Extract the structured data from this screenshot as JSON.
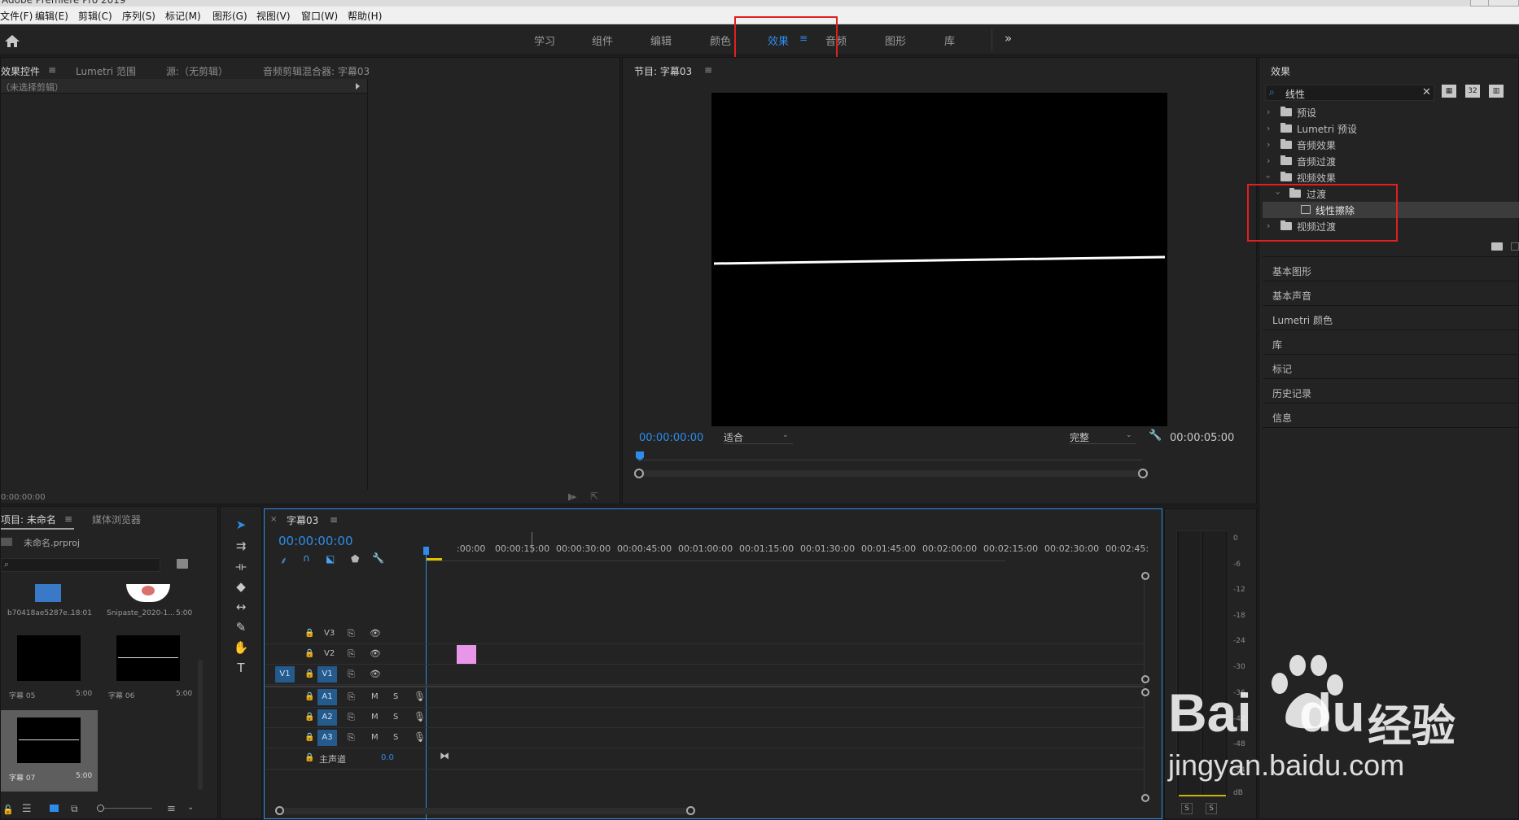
{
  "menubar": {
    "items": [
      "文件(F)",
      "编辑(E)",
      "剪辑(C)",
      "序列(S)",
      "标记(M)",
      "图形(G)",
      "视图(V)",
      "窗口(W)",
      "帮助(H)"
    ]
  },
  "workspaces": {
    "tabs": [
      "学习",
      "组件",
      "编辑",
      "颜色",
      "效果",
      "音频",
      "图形",
      "库"
    ],
    "active": "效果",
    "more": "»"
  },
  "effect_controls": {
    "tabs": [
      "效果控件",
      "Lumetri 范围",
      "源:（无剪辑）",
      "音频剪辑混合器: 字幕03"
    ],
    "no_clip": "（未选择剪辑）",
    "timecode": "0:00:00:00"
  },
  "program_monitor": {
    "title": "节目: 字幕03",
    "timecode_current": "00:00:00:00",
    "fit_label": "适合",
    "quality_label": "完整",
    "timecode_duration": "00:00:05:00"
  },
  "effects_panel": {
    "title": "效果",
    "search_value": "线性",
    "tree": [
      {
        "label": "预设",
        "icon": "preset-folder-icon",
        "level": 0,
        "expanded": false
      },
      {
        "label": "Lumetri 预设",
        "icon": "preset-folder-icon",
        "level": 0,
        "expanded": false
      },
      {
        "label": "音频效果",
        "icon": "folder-icon",
        "level": 0,
        "expanded": false
      },
      {
        "label": "音频过渡",
        "icon": "folder-icon",
        "level": 0,
        "expanded": false
      },
      {
        "label": "视频效果",
        "icon": "folder-icon",
        "level": 0,
        "expanded": true
      },
      {
        "label": "过渡",
        "icon": "folder-icon",
        "level": 1,
        "expanded": true
      },
      {
        "label": "线性擦除",
        "icon": "effect-icon",
        "level": 2,
        "selected": true
      },
      {
        "label": "视频过渡",
        "icon": "folder-icon",
        "level": 0,
        "expanded": false
      }
    ],
    "sections": [
      "基本图形",
      "基本声音",
      "Lumetri 颜色",
      "库",
      "标记",
      "历史记录",
      "信息"
    ]
  },
  "project": {
    "tabs": [
      "项目: 未命名",
      "媒体浏览器"
    ],
    "file": "未命名.prproj",
    "items": [
      {
        "name": "b70418ae5287e...",
        "dur": "18:01"
      },
      {
        "name": "Snipaste_2020-1...",
        "dur": "5:00"
      },
      {
        "name": "字幕 05",
        "dur": "5:00"
      },
      {
        "name": "字幕 06",
        "dur": "5:00"
      },
      {
        "name": "字幕 07",
        "dur": "5:00"
      }
    ]
  },
  "timeline": {
    "tab": "字幕03",
    "timecode": "00:00:00:00",
    "ruler": [
      ":00:00",
      "00:00:15:00",
      "00:00:30:00",
      "00:00:45:00",
      "00:01:00:00",
      "00:01:15:00",
      "00:01:30:00",
      "00:01:45:00",
      "00:02:00:00",
      "00:02:15:00",
      "00:02:30:00",
      "00:02:45:"
    ],
    "video_tracks": [
      "V3",
      "V2",
      "V1"
    ],
    "source_patch": "V1",
    "audio_tracks": [
      "A1",
      "A2",
      "A3"
    ],
    "mute_label": "M",
    "solo_label": "S",
    "master_label": "主声道",
    "master_value": "0.0"
  },
  "audio_meter": {
    "scale": [
      "0",
      "-6",
      "-12",
      "-18",
      "-24",
      "-30",
      "-36",
      "-42",
      "-48",
      "-54",
      "dB"
    ],
    "solo": [
      "S",
      "S"
    ]
  },
  "watermark": {
    "brand": "Bai",
    "brand2": "du",
    "cn": "经验",
    "url": "jingyan.baidu.com"
  },
  "colors": {
    "accent": "#2d8ceb",
    "highlight_box": "#e02020",
    "clip": "#e896e8"
  }
}
